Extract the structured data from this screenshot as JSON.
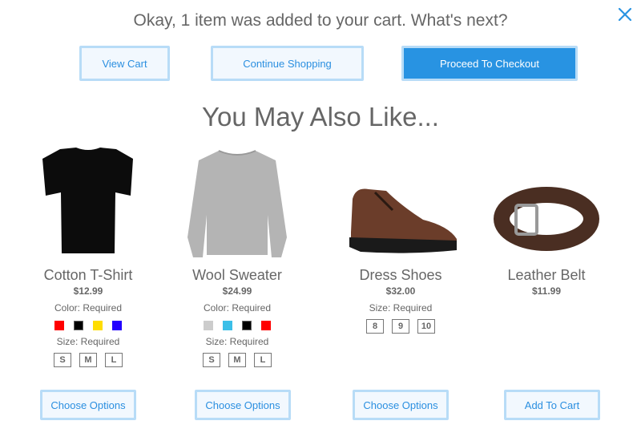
{
  "dialog": {
    "headline": "Okay, 1 item was added to your cart. What's next?",
    "close_icon": "close-icon",
    "accent": "#2893e2",
    "actions": {
      "view_cart": "View Cart",
      "continue_shopping": "Continue Shopping",
      "checkout": "Proceed To Checkout"
    }
  },
  "recommendations": {
    "title": "You May Also Like...",
    "products": [
      {
        "name": "Cotton T-Shirt",
        "price": "$12.99",
        "color_label": "Color: Required",
        "colors": [
          "#ff0000",
          "#000000",
          "#ffdd00",
          "#2200ff"
        ],
        "size_label": "Size: Required",
        "sizes": [
          "S",
          "M",
          "L"
        ],
        "button": "Choose Options"
      },
      {
        "name": "Wool Sweater",
        "price": "$24.99",
        "color_label": "Color: Required",
        "colors": [
          "#cccccc",
          "#3bbfe8",
          "#000000",
          "#ff0000"
        ],
        "size_label": "Size: Required",
        "sizes": [
          "S",
          "M",
          "L"
        ],
        "button": "Choose Options"
      },
      {
        "name": "Dress Shoes",
        "price": "$32.00",
        "size_label": "Size: Required",
        "sizes": [
          "8",
          "9",
          "10"
        ],
        "button": "Choose Options"
      },
      {
        "name": "Leather Belt",
        "price": "$11.99",
        "button": "Add To Cart"
      }
    ]
  }
}
